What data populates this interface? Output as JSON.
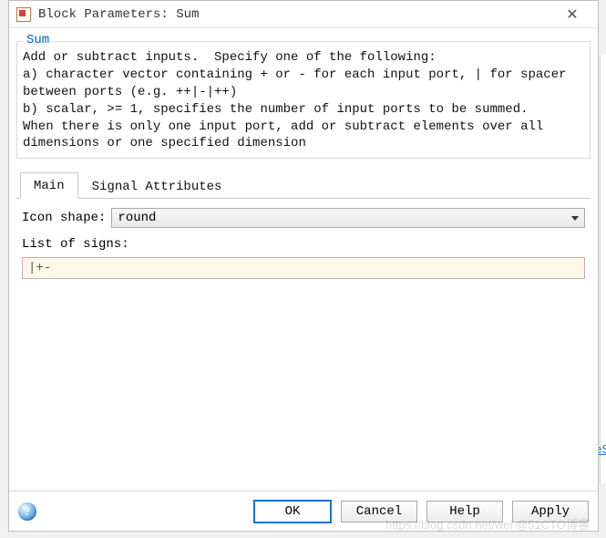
{
  "window": {
    "title": "Block Parameters: Sum",
    "close_glyph": "✕"
  },
  "group": {
    "legend": "Sum",
    "description": "Add or subtract inputs.  Specify one of the following:\na) character vector containing + or - for each input port, | for spacer between ports (e.g. ++|-|++)\nb) scalar, >= 1, specifies the number of input ports to be summed.\nWhen there is only one input port, add or subtract elements over all dimensions or one specified dimension"
  },
  "tabs": {
    "main": "Main",
    "signal_attributes": "Signal Attributes"
  },
  "form": {
    "icon_shape_label": "Icon shape:",
    "icon_shape_value": "round",
    "list_of_signs_label": "List of signs:",
    "list_of_signs_value": "|+-"
  },
  "footer": {
    "help_glyph": "?",
    "ok": "OK",
    "cancel": "Cancel",
    "help": "Help",
    "apply": "Apply"
  },
  "background": {
    "edge_link": "eS",
    "watermark": "https://blog.csdn.net/wei @51CTO博客"
  }
}
